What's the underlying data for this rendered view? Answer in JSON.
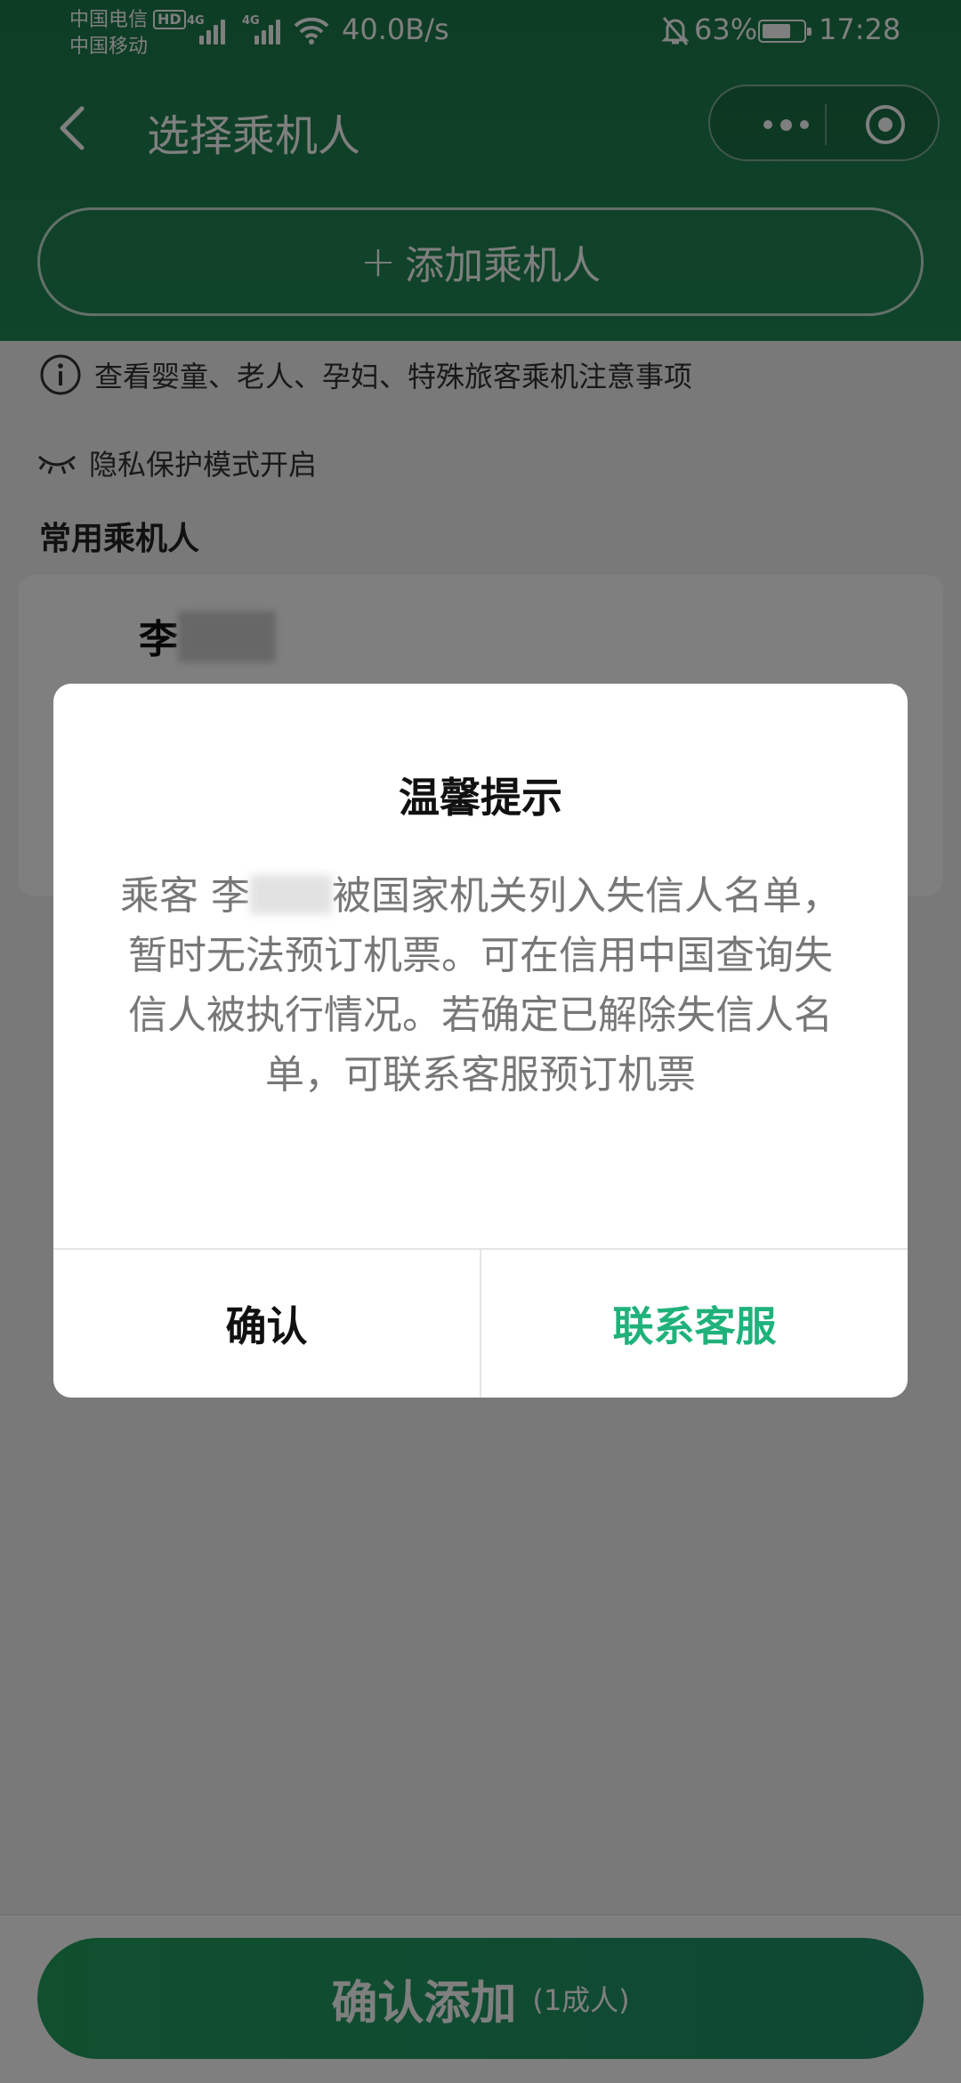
{
  "status_bar": {
    "carrier1": "中国电信",
    "hd": "HD",
    "carrier2": "中国移动",
    "net1": "4G",
    "net2": "4G",
    "speed": "40.0B/s",
    "battery": "63%",
    "time": "17:28"
  },
  "nav": {
    "title": "选择乘机人"
  },
  "add_passenger": {
    "plus": "+",
    "label": "添加乘机人"
  },
  "notice": "查看婴童、老人、孕妇、特殊旅客乘机注意事项",
  "privacy": "隐私保护模式开启",
  "section_title": "常用乘机人",
  "passenger": {
    "name": "李"
  },
  "footer": {
    "confirm_label": "确认添加",
    "count_label": "(1成人)"
  },
  "dialog": {
    "title": "温馨提示",
    "body_prefix": "乘客 李",
    "body_suffix": "被国家机关列入失信人名单，暂时无法预订机票。可在信用中国查询失信人被执行情况。若确定已解除失信人名单，可联系客服预订机票",
    "confirm": "确认",
    "contact": "联系客服"
  },
  "colors": {
    "header_green": "#1d7a4c",
    "accent_green": "#1fb27a"
  }
}
